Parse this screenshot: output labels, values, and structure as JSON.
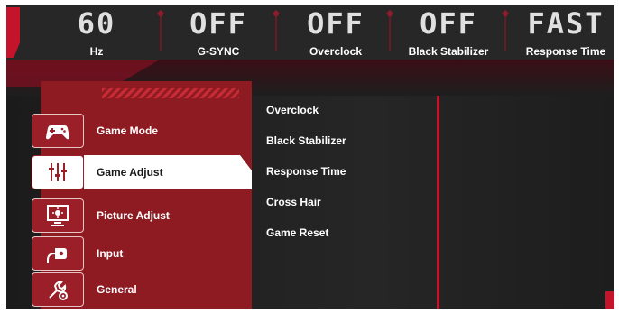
{
  "status": [
    {
      "value": "60",
      "label": "Hz"
    },
    {
      "value": "OFF",
      "label": "G-SYNC"
    },
    {
      "value": "OFF",
      "label": "Overclock"
    },
    {
      "value": "OFF",
      "label": "Black Stabilizer"
    },
    {
      "value": "FAST",
      "label": "Response Time"
    }
  ],
  "menu": [
    {
      "label": "Game Mode",
      "icon": "gamepad-icon"
    },
    {
      "label": "Game Adjust",
      "icon": "sliders-icon",
      "active": true
    },
    {
      "label": "Picture Adjust",
      "icon": "picture-adjust-icon"
    },
    {
      "label": "Input",
      "icon": "input-icon"
    },
    {
      "label": "General",
      "icon": "settings-icon"
    }
  ],
  "submenu": [
    "Overclock",
    "Black Stabilizer",
    "Response Time",
    "Cross Hair",
    "Game Reset"
  ],
  "colors": {
    "accent": "#c4142c",
    "panel": "#8e1a22",
    "background": "#202020"
  }
}
